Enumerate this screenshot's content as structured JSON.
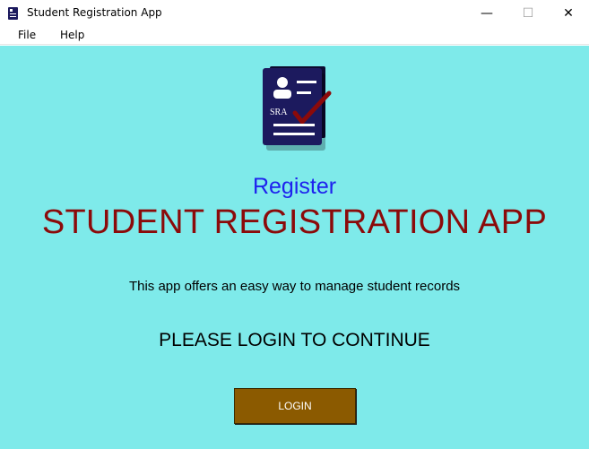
{
  "window": {
    "title": "Student Registration App",
    "minimize_glyph": "—",
    "maximize_glyph": "☐",
    "close_glyph": "✕"
  },
  "menu": {
    "items": [
      {
        "label": "File"
      },
      {
        "label": "Help"
      }
    ]
  },
  "logo": {
    "text": "SRA",
    "icon": "student-id-card-checkmark-icon"
  },
  "main": {
    "register_label": "Register",
    "app_title": "STUDENT REGISTRATION APP",
    "description": "This app offers an easy way to manage student records",
    "prompt": "PLEASE LOGIN TO CONTINUE",
    "login_button": "LOGIN"
  },
  "colors": {
    "background": "#7eeaea",
    "register": "#1e22ee",
    "app_title": "#8b0a0a",
    "login_button": "#8b5a00",
    "card": "#1c1a5e",
    "check": "#8b0a0a"
  }
}
